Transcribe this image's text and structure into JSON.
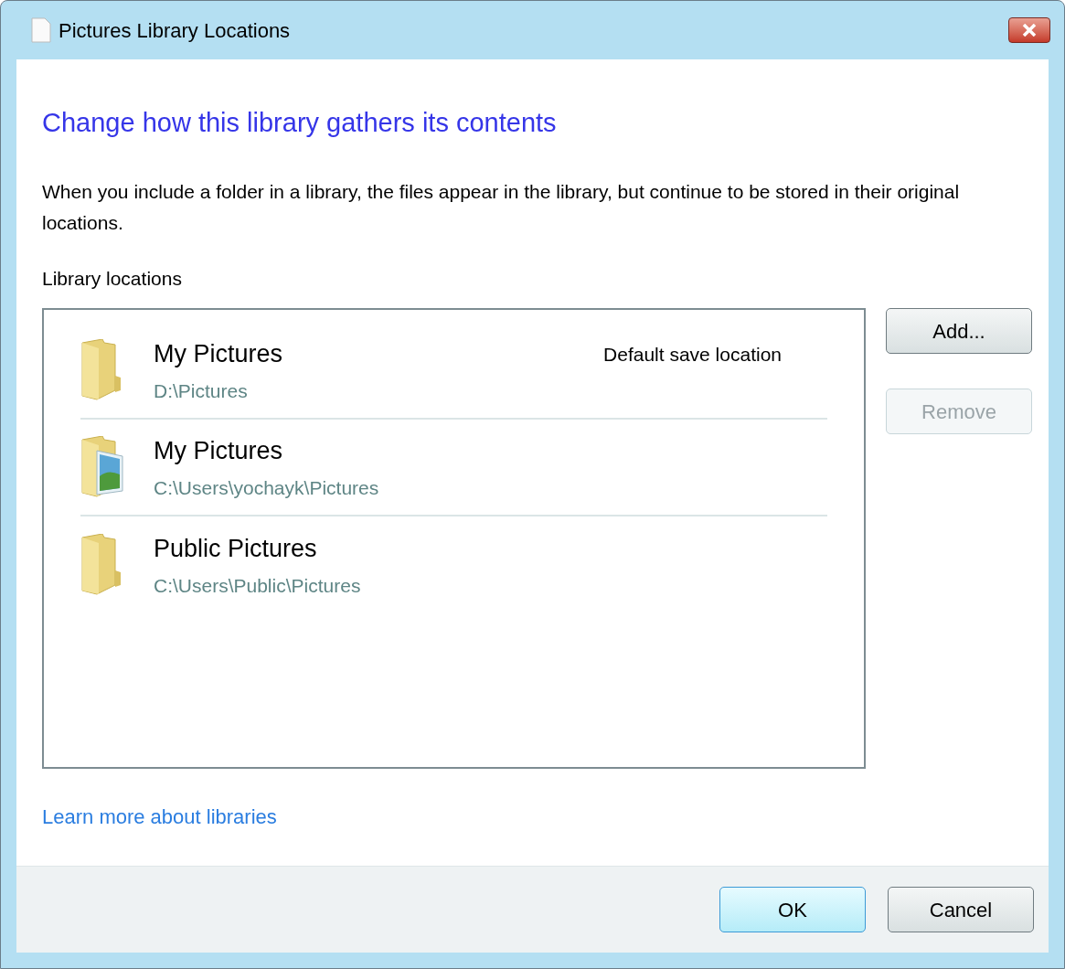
{
  "window": {
    "title": "Pictures Library Locations"
  },
  "heading": "Change how this library gathers its contents",
  "description": "When you include a folder in a library, the files appear in the library, but continue to be stored in their original locations.",
  "locations_label": "Library locations",
  "locations": [
    {
      "name": "My Pictures",
      "path": "D:\\Pictures",
      "badge": "Default save location",
      "kind": "folder"
    },
    {
      "name": "My Pictures",
      "path": "C:\\Users\\yochayk\\Pictures",
      "kind": "photo-folder"
    },
    {
      "name": "Public Pictures",
      "path": "C:\\Users\\Public\\Pictures",
      "kind": "folder"
    }
  ],
  "side_buttons": [
    {
      "label": "Add...",
      "disabled": false
    },
    {
      "label": "Remove",
      "disabled": true
    }
  ],
  "link": "Learn more about libraries",
  "footer_buttons": [
    {
      "label": "OK",
      "default": true
    },
    {
      "label": "Cancel",
      "default": false
    }
  ]
}
